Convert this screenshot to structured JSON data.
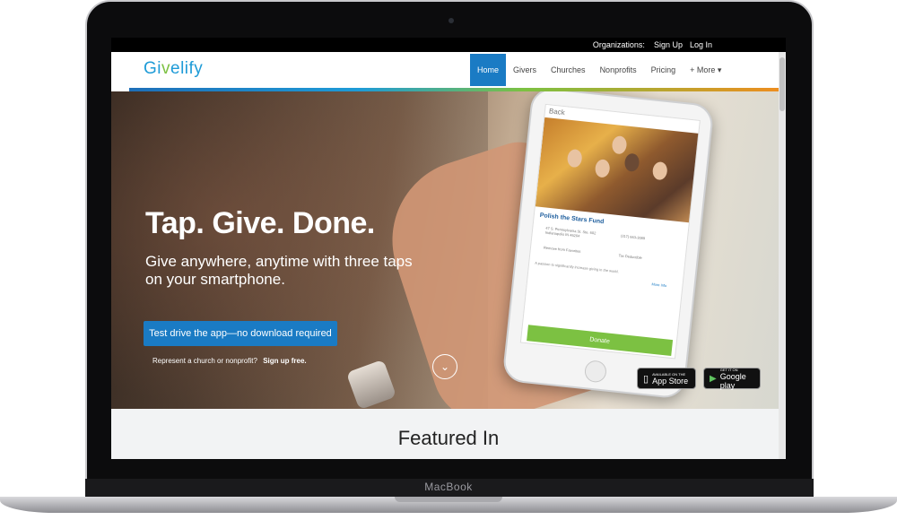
{
  "device": {
    "brand": "MacBook"
  },
  "top_bar": {
    "organizations_label": "Organizations:",
    "signup": "Sign Up",
    "login": "Log In"
  },
  "logo": {
    "part1": "Gi",
    "part2": "v",
    "part3": "elify"
  },
  "nav": {
    "items": [
      {
        "label": "Home",
        "active": true
      },
      {
        "label": "Givers"
      },
      {
        "label": "Churches"
      },
      {
        "label": "Nonprofits"
      },
      {
        "label": "Pricing"
      },
      {
        "label": "+ More ▾"
      }
    ]
  },
  "hero": {
    "headline": "Tap. Give. Done.",
    "subline": "Give anywhere, anytime with three taps on your smartphone.",
    "cta_label": "Test drive the app—no download required",
    "represent_text": "Represent a church or nonprofit?",
    "signup_link": "Sign up free.",
    "scroll_icon": "chevron-down-icon"
  },
  "phone": {
    "back_label": "Back",
    "fund_name": "Polish the Stars Fund",
    "address": "47 S. Pennsylvania St. Ste. 602 Indianapolis IN 46204",
    "phone": "(317) 663-3089",
    "favorite": "Remove from Favorites",
    "tax": "Tax Deductible",
    "description": "A passion to significantly increase giving in the world.",
    "more_info": "More Info",
    "donate_label": "Donate"
  },
  "badges": {
    "appstore_small": "AVAILABLE ON THE",
    "appstore_big": "App Store",
    "googleplay_small": "GET IT ON",
    "googleplay_big": "Google play"
  },
  "featured": {
    "title": "Featured In"
  },
  "colors": {
    "primary": "#1a7bc4",
    "brand_green": "#7cc142",
    "brand_blue": "#1e9bd7"
  }
}
